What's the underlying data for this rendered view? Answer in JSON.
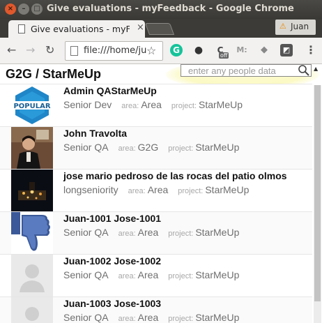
{
  "window": {
    "title": "Give evaluations - myFeedback - Google Chrome"
  },
  "tab": {
    "label": "Give evaluations - myF",
    "close": "×"
  },
  "profile": {
    "warning": "⚠",
    "name": "Juan"
  },
  "toolbar": {
    "url": "file:///home/ju",
    "ext_c_badge": "off",
    "ext_m": "M:"
  },
  "page": {
    "title": "G2G / StarMeUp",
    "search_placeholder": "enter any people data"
  },
  "labels": {
    "area": "area:",
    "project": "project:"
  },
  "people": [
    {
      "name": "Admin QAStarMeUp",
      "role": "Senior Dev",
      "area": "Area",
      "project": "StarMeUp",
      "avatar": "popular-logo"
    },
    {
      "name": "John Travolta",
      "role": "Senior QA",
      "area": "G2G",
      "project": "StarMeUp",
      "avatar": "photo"
    },
    {
      "name": "jose mario pedroso de las rocas del patio olmos",
      "role": "longseniority",
      "area": "Area",
      "project": "StarMeUp",
      "avatar": "night-photo"
    },
    {
      "name": "Juan-1001 Jose-1001",
      "role": "Senior QA",
      "area": "Area",
      "project": "StarMeUp",
      "avatar": "thumbs-down"
    },
    {
      "name": "Juan-1002 Jose-1002",
      "role": "Senior QA",
      "area": "Area",
      "project": "StarMeUp",
      "avatar": "default-user"
    },
    {
      "name": "Juan-1003 Jose-1003",
      "role": "Senior QA",
      "area": "Area",
      "project": "StarMeUp",
      "avatar": "default-user"
    }
  ],
  "colors": {
    "close_button": "#e0582c",
    "search_highlight": "#fbf9c4",
    "facebook_blue": "#3b5998"
  }
}
